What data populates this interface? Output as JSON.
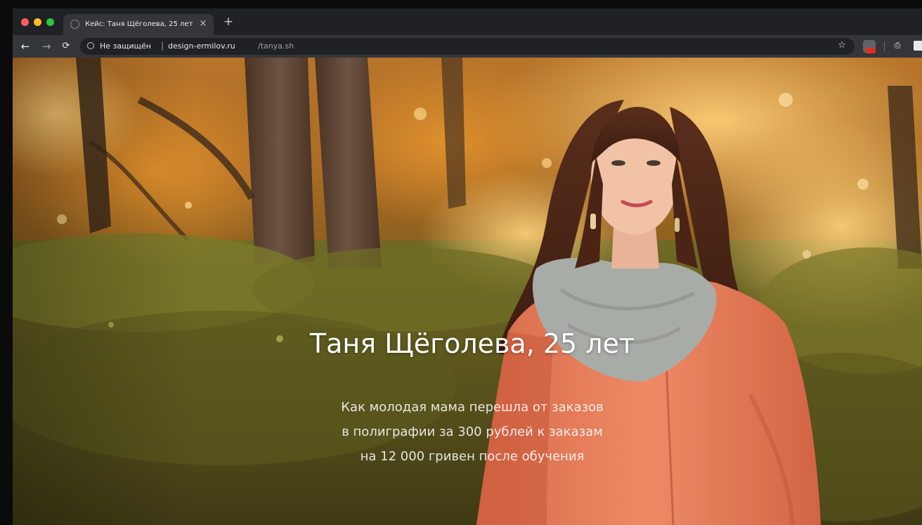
{
  "browser": {
    "tab": {
      "title": "Кейс: Таня Щёголева, 25 лет",
      "close_glyph": "×"
    },
    "new_tab_glyph": "+",
    "toolbar": {
      "back_glyph": "←",
      "forward_glyph": "→",
      "reload_glyph": "⟳"
    },
    "address_bar": {
      "security_label": "Не защищён",
      "separator": "|",
      "domain": "design-ermilov.ru",
      "path": "/tanya.sh"
    },
    "icons": {
      "bookmark_star": "☆",
      "print": "⎙"
    }
  },
  "hero": {
    "title": "Таня Щёголева, 25 лет",
    "subtitle_lines": [
      "Как молодая мама перешла от заказов",
      "в полиграфии за 300 рублей к заказам",
      "на 12 000 гривен после обучения"
    ]
  },
  "colors": {
    "window_bg": "#202124",
    "toolbar_bg": "#35363a",
    "title_text": "#ffffff"
  }
}
